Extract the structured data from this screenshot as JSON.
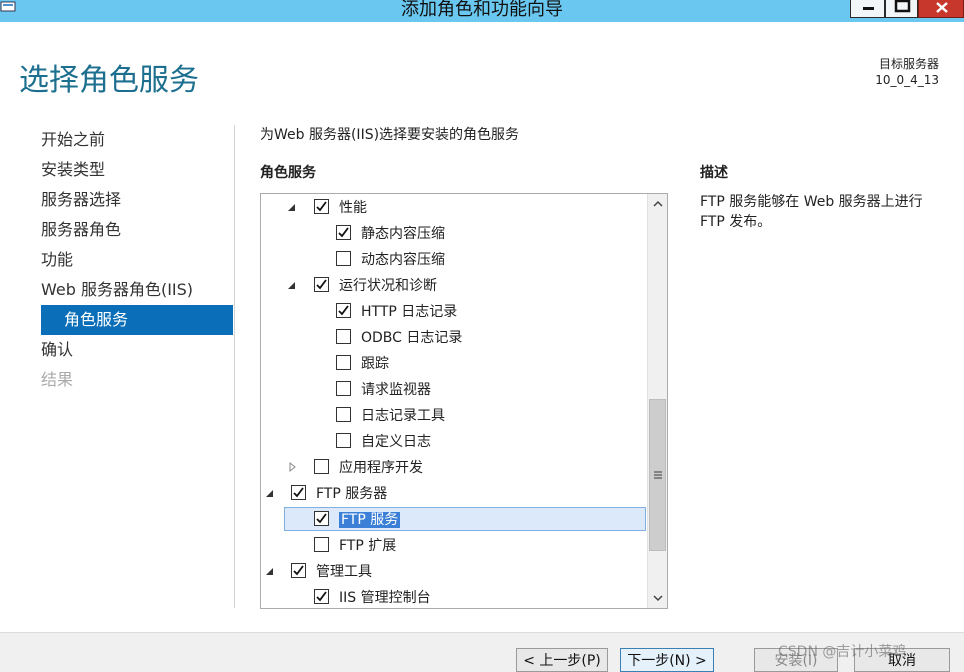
{
  "window": {
    "title": "添加角色和功能向导"
  },
  "header": {
    "page_title": "选择角色服务",
    "target_label": "目标服务器",
    "target_value": "10_0_4_13"
  },
  "nav": {
    "items": [
      {
        "label": "开始之前",
        "state": "normal"
      },
      {
        "label": "安装类型",
        "state": "normal"
      },
      {
        "label": "服务器选择",
        "state": "normal"
      },
      {
        "label": "服务器角色",
        "state": "normal"
      },
      {
        "label": "功能",
        "state": "normal"
      },
      {
        "label": "Web 服务器角色(IIS)",
        "state": "normal"
      },
      {
        "label": "角色服务",
        "state": "active"
      },
      {
        "label": "确认",
        "state": "normal"
      },
      {
        "label": "结果",
        "state": "disabled"
      }
    ]
  },
  "content": {
    "instruction": "为Web 服务器(IIS)选择要安装的角色服务",
    "column_heading": "角色服务",
    "description_heading": "描述",
    "description_text": "FTP 服务能够在 Web 服务器上进行 FTP 发布。"
  },
  "tree": {
    "rows": [
      {
        "label": "性能",
        "level": 2,
        "checked": true,
        "expander": "expanded"
      },
      {
        "label": "静态内容压缩",
        "level": 3,
        "checked": true,
        "expander": "none"
      },
      {
        "label": "动态内容压缩",
        "level": 3,
        "checked": false,
        "expander": "none"
      },
      {
        "label": "运行状况和诊断",
        "level": 2,
        "checked": true,
        "expander": "expanded"
      },
      {
        "label": "HTTP 日志记录",
        "level": 3,
        "checked": true,
        "expander": "none"
      },
      {
        "label": "ODBC 日志记录",
        "level": 3,
        "checked": false,
        "expander": "none"
      },
      {
        "label": "跟踪",
        "level": 3,
        "checked": false,
        "expander": "none"
      },
      {
        "label": "请求监视器",
        "level": 3,
        "checked": false,
        "expander": "none"
      },
      {
        "label": "日志记录工具",
        "level": 3,
        "checked": false,
        "expander": "none"
      },
      {
        "label": "自定义日志",
        "level": 3,
        "checked": false,
        "expander": "none"
      },
      {
        "label": "应用程序开发",
        "level": 2,
        "checked": false,
        "expander": "collapsed"
      },
      {
        "label": "FTP 服务器",
        "level": 1,
        "checked": true,
        "expander": "expanded"
      },
      {
        "label": "FTP 服务",
        "level": 2,
        "checked": true,
        "expander": "none",
        "selected": true
      },
      {
        "label": "FTP 扩展",
        "level": 2,
        "checked": false,
        "expander": "none"
      },
      {
        "label": "管理工具",
        "level": 1,
        "checked": true,
        "expander": "expanded"
      },
      {
        "label": "IIS 管理控制台",
        "level": 2,
        "checked": true,
        "expander": "none"
      }
    ]
  },
  "footer": {
    "prev_label": "< 上一步(P)",
    "next_label": "下一步(N) >",
    "install_label": "安装(I)",
    "cancel_label": "取消",
    "watermark": "CSDN @吉计小菜鸡"
  },
  "colors": {
    "titlebar": "#6ac8f0",
    "accent": "#0a6fb8",
    "page_title": "#1d6f8f"
  },
  "icons": {
    "expanded": "triangle-expanded-icon",
    "collapsed": "triangle-collapsed-icon",
    "check": "checkmark-icon"
  }
}
